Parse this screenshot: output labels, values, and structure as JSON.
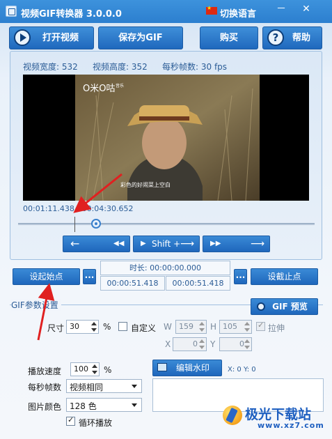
{
  "window": {
    "title": "视频GIF转换器 3.0.0.0",
    "lang_label": "切换语言",
    "minimize_glyph": "－",
    "close_glyph": "✕"
  },
  "toolbar": {
    "open_video": "打开视频",
    "save_gif": "保存为GIF",
    "buy": "购买",
    "help": "帮助",
    "help_glyph": "?"
  },
  "video_info": {
    "width_label": "视频宽度: 532",
    "height_label": "视频高度: 352",
    "fps_label": "每秒帧数: 30 fps"
  },
  "video_frame": {
    "channel_logo": "O米O咕",
    "channel_sub": "音乐",
    "subtitle": "彩色的好闹菜上空白"
  },
  "playback": {
    "time_display": "00:01:11.438 / 00:04:30.652",
    "position_fraction": 0.264,
    "start_marker_fraction": 0.19,
    "rewind_left": "←",
    "rewind_fast": "◀◀",
    "shift_play": "Shift +",
    "shift_arrow": "⟶",
    "forward_fast": "▶▶",
    "forward_right": "⟶"
  },
  "range": {
    "set_start": "设起始点",
    "set_end": "设截止点",
    "dots": "...",
    "duration_label": "时长: 00:00:00.000",
    "start_time": "00:00:51.418",
    "end_time": "00:00:51.418"
  },
  "gif_params": {
    "section_title": "GIF参数设置",
    "preview_btn": "GIF 预览",
    "size_label": "尺寸",
    "size_value": "30",
    "percent": "%",
    "custom_label": "自定义",
    "w_label": "W",
    "w_value": "159",
    "h_label": "H",
    "h_value": "105",
    "stretch_label": "拉伸",
    "x_label": "X",
    "x_value": "0",
    "y_label": "Y",
    "y_value": "0",
    "speed_label": "播放速度",
    "speed_value": "100",
    "speed_percent": "%",
    "fps_label": "每秒帧数",
    "fps_value": "视频相同",
    "color_label": "图片颜色",
    "color_value": "128 色",
    "loop_label": "循环播放",
    "edit_watermark": "编辑水印",
    "coords": "X: 0  Y: 0"
  },
  "branding": {
    "logo_text": "极光下载站",
    "logo_url": "www.xz7.com"
  },
  "colors": {
    "titlebar": "#2c7fcf",
    "button": "#1f68bd",
    "accent_text": "#2b5c96",
    "annotation_arrow": "#e02020"
  }
}
